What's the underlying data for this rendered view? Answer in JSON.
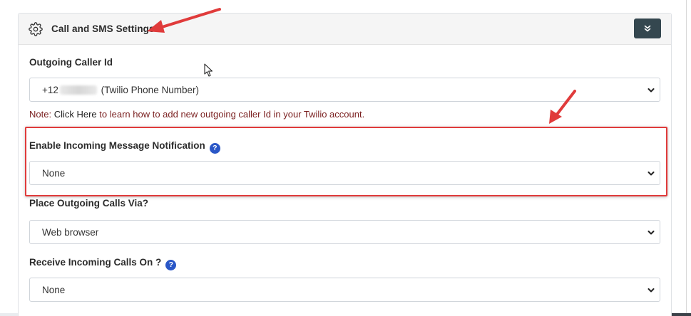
{
  "panel": {
    "title": "Call and SMS Settings",
    "collapse_icon": "double-chevron-down-icon"
  },
  "outgoing_caller_id": {
    "label": "Outgoing Caller Id",
    "value_prefix": "+12",
    "value_suffix": "(Twilio Phone Number)"
  },
  "note": {
    "prefix": "Note: ",
    "link": "Click Here",
    "suffix": " to learn how to add new outgoing caller Id in your Twilio account."
  },
  "incoming_notification": {
    "label": "Enable Incoming Message Notification",
    "help": "?",
    "value": "None"
  },
  "outgoing_calls": {
    "label": "Place Outgoing Calls Via?",
    "value": "Web browser"
  },
  "incoming_calls": {
    "label": "Receive Incoming Calls On ?",
    "help": "?",
    "value": "None"
  },
  "colors": {
    "annotation": "#e03b3b",
    "header_button": "#34474f",
    "help_icon": "#2a57c7",
    "note_text": "#7a1f1f"
  }
}
